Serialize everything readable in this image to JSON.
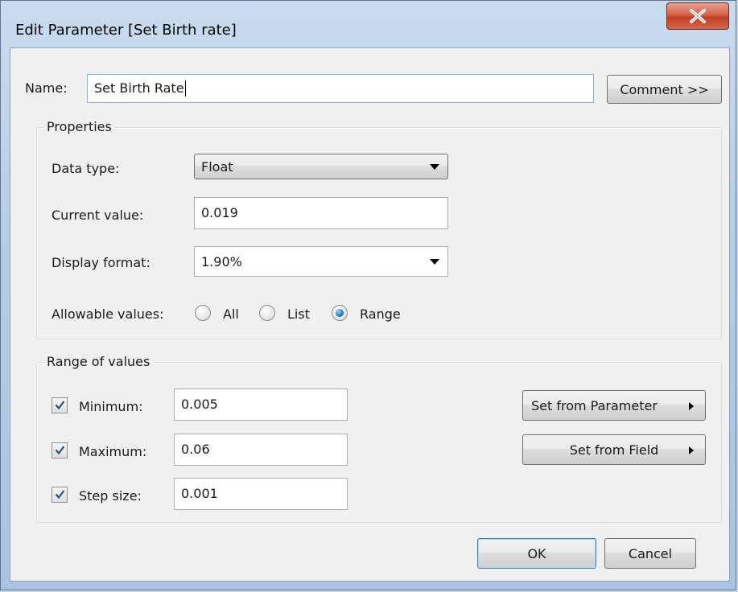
{
  "window": {
    "title": "Edit Parameter [Set Birth rate]",
    "close_label": "X"
  },
  "name_row": {
    "label": "Name:",
    "value": "Set Birth Rate",
    "comment_button": "Comment >>"
  },
  "properties": {
    "group_title": "Properties",
    "data_type_label": "Data type:",
    "data_type_value": "Float",
    "current_value_label": "Current value:",
    "current_value": "0.019",
    "display_format_label": "Display format:",
    "display_format_value": "1.90%",
    "allowable_label": "Allowable values:",
    "allowable_options": [
      "All",
      "List",
      "Range"
    ],
    "allowable_selected": "Range"
  },
  "range": {
    "group_title": "Range of values",
    "minimum_label": "Minimum:",
    "minimum_value": "0.005",
    "minimum_checked": true,
    "maximum_label": "Maximum:",
    "maximum_value": "0.06",
    "maximum_checked": true,
    "step_label": "Step size:",
    "step_value": "0.001",
    "step_checked": true,
    "set_from_parameter": "Set from Parameter",
    "set_from_field": "Set from Field"
  },
  "footer": {
    "ok": "OK",
    "cancel": "Cancel"
  },
  "colors": {
    "title_bar": "#b7cde6",
    "close_button": "#c9452a",
    "dialog_bg": "#f0f0f0",
    "radio_selected": "#2a7fd0"
  },
  "icons": {
    "close": "close-icon",
    "dropdown": "chevron-down-icon",
    "submenu": "triangle-right-icon",
    "check": "checkmark-icon"
  }
}
